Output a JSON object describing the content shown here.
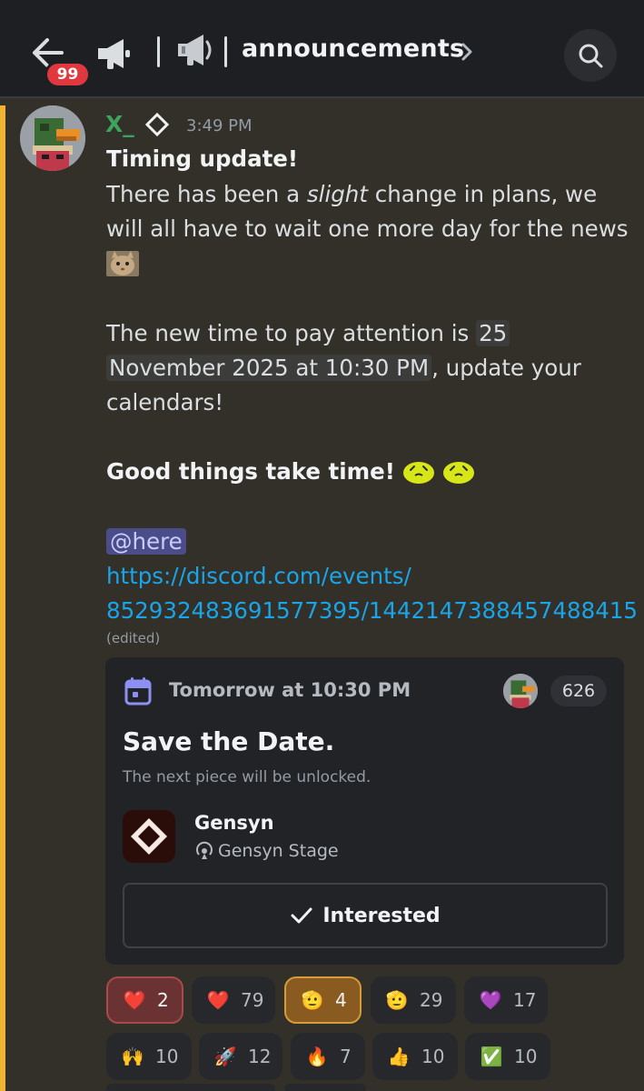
{
  "header": {
    "unread_badge": "99",
    "channel_name": "announcements"
  },
  "message": {
    "author": "X_",
    "timestamp": "3:49 PM",
    "title": "Timing update!",
    "line1_prefix": "There has been a ",
    "line1_emph": "slight",
    "line1_suffix": " change in plans, we",
    "line2": "will all have to wait one more day for the news",
    "line3_prefix": " The new time to pay attention is ",
    "line3_time": "25",
    "line4_time": "November 2025 at 10:30 PM",
    "line4_suffix": ", update your",
    "line5": "calendars!",
    "good_things": "Good things take time!",
    "mention": "@here",
    "link_line1": "https://discord.com/events/",
    "link_line2": "852932483691577395/1442147388457488415",
    "edited": "(edited)"
  },
  "event": {
    "time": "Tomorrow at 10:30 PM",
    "interested_count": "626",
    "title": "Save the Date.",
    "description": "The next piece will be unlocked.",
    "guild_name": "Gensyn",
    "stage_name": "Gensyn Stage",
    "interested_label": "Interested"
  },
  "reactions": [
    {
      "emoji": "❤️",
      "count": "2",
      "active": "red"
    },
    {
      "emoji": "❤️",
      "count": "79",
      "active": ""
    },
    {
      "emoji": "🫡",
      "count": "4",
      "active": "orange"
    },
    {
      "emoji": "🫡",
      "count": "29",
      "active": ""
    },
    {
      "emoji": "💜",
      "count": "17",
      "active": ""
    },
    {
      "emoji": "🙌",
      "count": "10",
      "active": ""
    },
    {
      "emoji": "🚀",
      "count": "12",
      "active": ""
    },
    {
      "emoji": "🔥",
      "count": "7",
      "active": ""
    },
    {
      "emoji": "👍",
      "count": "10",
      "active": ""
    },
    {
      "emoji": "✅",
      "count": "10",
      "active": ""
    }
  ],
  "colors": {
    "author": "#3ba55d",
    "link": "#1aa5e8",
    "mention_bar": "#f0b232",
    "badge": "#e0383e"
  }
}
